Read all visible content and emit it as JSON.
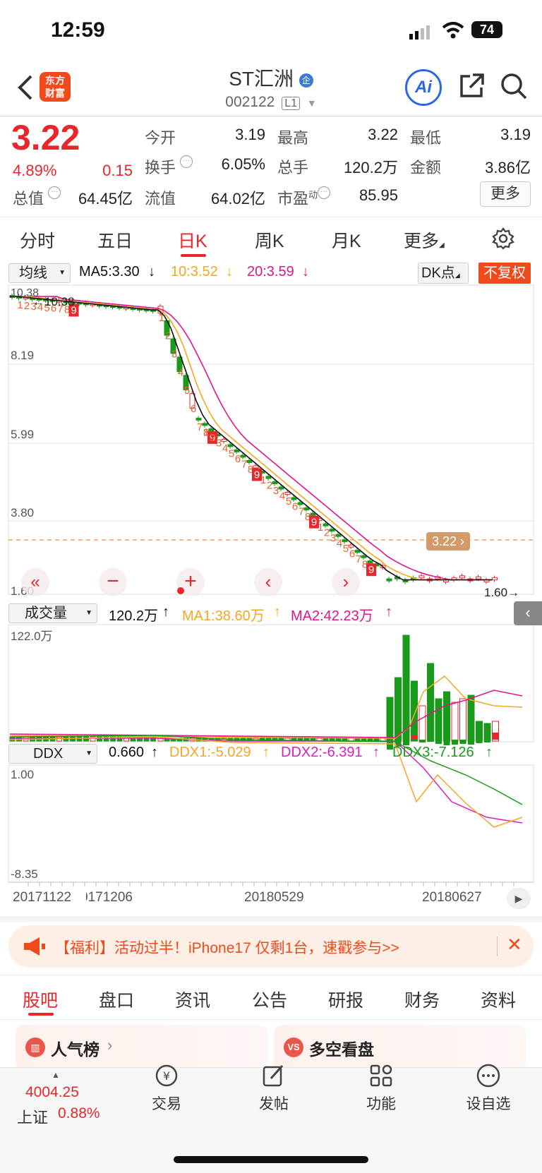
{
  "status": {
    "time": "12:59",
    "battery": "74"
  },
  "header": {
    "title": "ST汇洲",
    "code": "002122",
    "level_badge": "L1",
    "brand_logo": "东方财富",
    "ai_label": "Ai"
  },
  "quote": {
    "price": "3.22",
    "change_pct": "4.89%",
    "change_amt": "0.15",
    "fields": [
      {
        "label": "今开",
        "value": "3.19"
      },
      {
        "label": "最高",
        "value": "3.22"
      },
      {
        "label": "最低",
        "value": "3.19"
      },
      {
        "label": "换手",
        "value": "6.05%"
      },
      {
        "label": "总手",
        "value": "120.2万"
      },
      {
        "label": "金额",
        "value": "3.86亿"
      },
      {
        "label": "总值",
        "value": "64.45亿"
      },
      {
        "label": "流值",
        "value": "64.02亿"
      },
      {
        "label": "市盈",
        "value": "85.95"
      }
    ],
    "pe_sup": "动",
    "more_label": "更多"
  },
  "period_tabs": [
    "分时",
    "五日",
    "日K",
    "周K",
    "月K",
    "更多"
  ],
  "ma_bar": {
    "selector": "均线",
    "ma5": "MA5:3.30",
    "ma10": "10:3.52",
    "ma20": "20:3.59",
    "dk": "DK点",
    "fq": "不复权"
  },
  "kline": {
    "y_labels": [
      "10.38",
      "8.19",
      "5.99",
      "3.80",
      "1.60"
    ],
    "high_marker": "10.38",
    "low_marker": "1.60",
    "price_tag": "3.22",
    "seq_numbers": [
      "1",
      "2",
      "3",
      "4",
      "5",
      "6",
      "7",
      "8",
      "9"
    ]
  },
  "volume_bar": {
    "selector": "成交量",
    "vol": "120.2万",
    "ma1": "MA1:38.60万",
    "ma2": "MA2:42.23万",
    "max_label": "122.0万"
  },
  "ddx_bar": {
    "selector": "DDX",
    "ddx": "0.660",
    "ddx1": "DDX1:-5.029",
    "ddx2": "DDX2:-6.391",
    "ddx3": "DDX3:-7.126",
    "top": "1.00",
    "bottom": "-8.35"
  },
  "dates": [
    "20171122",
    "20171206",
    "20180529",
    "20180627"
  ],
  "banner": {
    "text": "【福利】活动过半！iPhone17 仅剩1台，速戳参与>>"
  },
  "sub_tabs": [
    "股吧",
    "盘口",
    "资讯",
    "公告",
    "研报",
    "财务",
    "资料"
  ],
  "cards": [
    {
      "label": "人气榜"
    },
    {
      "label": "多空看盘"
    }
  ],
  "bottom_nav": {
    "index_value": "4004.25",
    "index_name": "上证",
    "index_change": "0.88%",
    "items": [
      "交易",
      "发帖",
      "功能",
      "设自选"
    ]
  },
  "colors": {
    "up": "#e8262d",
    "down": "#1a9a1a",
    "ma5": "#111111",
    "ma10": "#f5a623",
    "ma20": "#e0148c",
    "accent": "#e8262d"
  }
}
